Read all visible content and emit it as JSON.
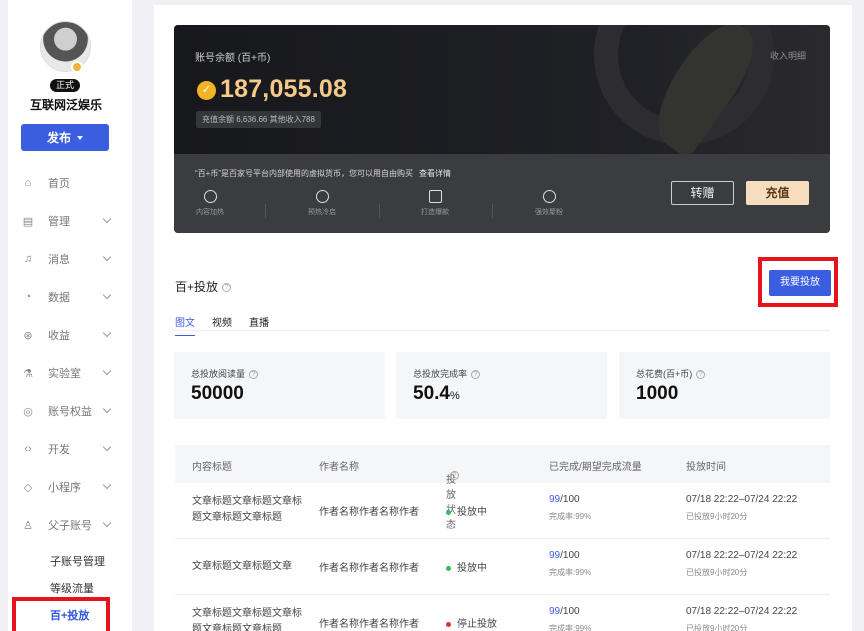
{
  "sidebar": {
    "status_badge": "正式",
    "username": "互联网泛娱乐",
    "publish_label": "发布",
    "items": [
      {
        "label": "首页",
        "icon": "home-icon",
        "glyph": "⌂",
        "has_chevron": false
      },
      {
        "label": "管理",
        "icon": "document-icon",
        "glyph": "▤",
        "has_chevron": true
      },
      {
        "label": "消息",
        "icon": "bell-icon",
        "glyph": "♫",
        "has_chevron": true
      },
      {
        "label": "数据",
        "icon": "chart-pie-icon",
        "glyph": "◔",
        "has_chevron": true
      },
      {
        "label": "收益",
        "icon": "money-icon",
        "glyph": "⊛",
        "has_chevron": true
      },
      {
        "label": "实验室",
        "icon": "flask-icon",
        "glyph": "⚗",
        "has_chevron": true
      },
      {
        "label": "账号权益",
        "icon": "settings-icon",
        "glyph": "◎",
        "has_chevron": true
      },
      {
        "label": "开发",
        "icon": "code-icon",
        "glyph": "‹›",
        "has_chevron": true
      },
      {
        "label": "小程序",
        "icon": "miniprogram-icon",
        "glyph": "◇",
        "has_chevron": true
      },
      {
        "label": "父子账号",
        "icon": "user-icon",
        "glyph": "♙",
        "has_chevron": true
      }
    ],
    "sub_items": [
      "子账号管理",
      "等级流量",
      "百+投放"
    ]
  },
  "balance": {
    "label": "账号余额 (百+币)",
    "detail_link": "收入明细",
    "amount": "187,055.08",
    "sub_amount": "充值余额 6,636.66   其他收入788",
    "description": "“百+币”是百家号平台内部使用的虚拟货币，您可以用自由购买",
    "description_link": "查看详情",
    "features": [
      "内容加热",
      "预热冷启",
      "打造爆款",
      "强效聚粉"
    ],
    "transfer_label": "转赠",
    "recharge_label": "充值"
  },
  "section": {
    "title": "百+投放",
    "invest_label": "我要投放",
    "tabs": [
      "图文",
      "视频",
      "直播"
    ]
  },
  "stats": [
    {
      "label": "总投放阅读量",
      "value": "50000",
      "unit": ""
    },
    {
      "label": "总投放完成率",
      "value": "50.4",
      "unit": "%"
    },
    {
      "label": "总花费(百+币)",
      "value": "1000",
      "unit": ""
    }
  ],
  "table": {
    "headers": [
      "内容标题",
      "作者名称",
      "投放状态",
      "已完成/期望完成流量",
      "投放时间"
    ],
    "rows": [
      {
        "title": "文章标题文章标题文章标题文章标题文章标题",
        "author": "作者名称作者名称作者",
        "status": "投放中",
        "status_color": "#2fbf5a",
        "done": "99",
        "target": "/100",
        "rate": "完成率:99%",
        "time": "07/18 22:22–07/24 22:22",
        "elapsed": "已投放9小时20分"
      },
      {
        "title": "文章标题文章标题文章",
        "author": "作者名称作者名称作者",
        "status": "投放中",
        "status_color": "#2fbf5a",
        "done": "99",
        "target": "/100",
        "rate": "完成率:99%",
        "time": "07/18 22:22–07/24 22:22",
        "elapsed": "已投放9小时20分"
      },
      {
        "title": "文章标题文章标题文章标题文章标题文章标题",
        "author": "作者名称作者名称作者",
        "status": "停止投放",
        "status_color": "#e5312f",
        "done": "99",
        "target": "/100",
        "rate": "完成率:99%",
        "time": "07/18 22:22–07/24 22:22",
        "elapsed": "已投放9小时20分"
      }
    ]
  }
}
